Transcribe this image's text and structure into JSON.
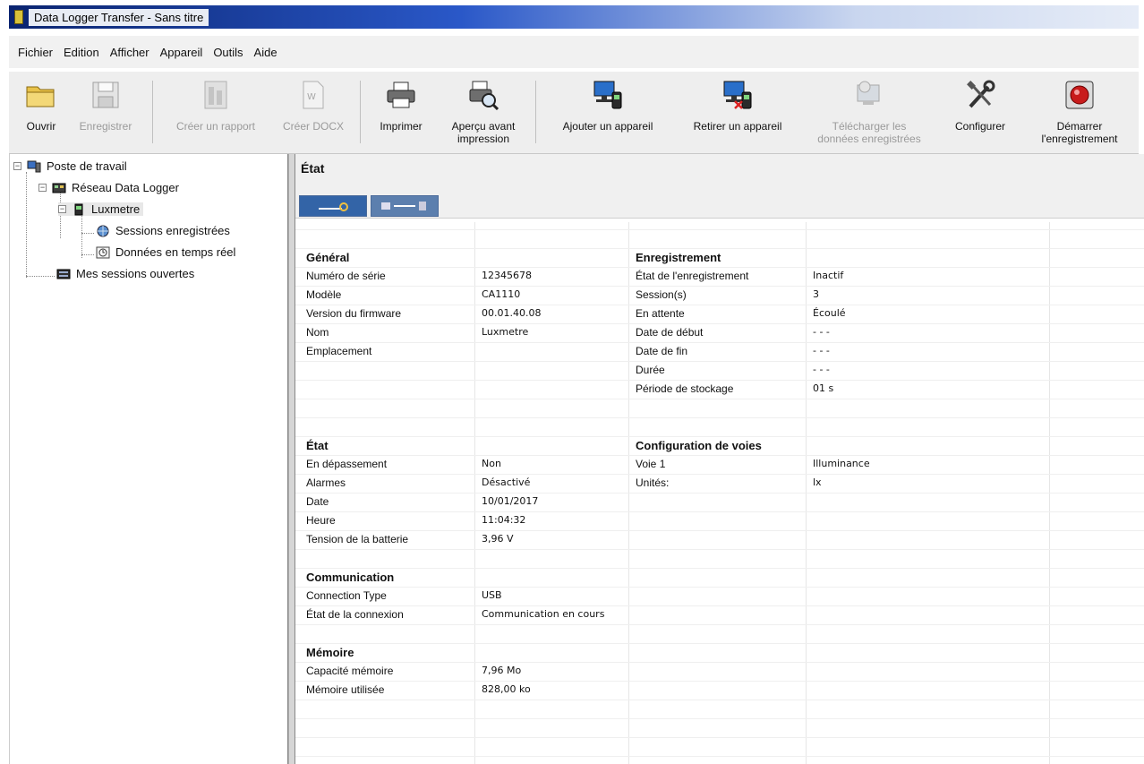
{
  "window": {
    "title": "Data Logger Transfer - Sans titre"
  },
  "menu": [
    "Fichier",
    "Edition",
    "Afficher",
    "Appareil",
    "Outils",
    "Aide"
  ],
  "toolbar": {
    "open": "Ouvrir",
    "save": "Enregistrer",
    "report": "Créer un rapport",
    "docx": "Créer DOCX",
    "print": "Imprimer",
    "preview_l1": "Aperçu avant",
    "preview_l2": "impression",
    "add_device": "Ajouter un appareil",
    "remove_device": "Retirer un appareil",
    "download_l1": "Télécharger les",
    "download_l2": "données enregistrées",
    "configure": "Configurer",
    "start_l1": "Démarrer",
    "start_l2": "l'enregistrement"
  },
  "tree": {
    "workstation": "Poste de travail",
    "network": "Réseau Data Logger",
    "device": "Luxmetre",
    "sessions": "Sessions enregistrées",
    "realtime": "Données en temps réel",
    "open_sessions": "Mes sessions ouvertes"
  },
  "panel": {
    "title": "État"
  },
  "left_sections": {
    "general": {
      "title": "Général",
      "rows": [
        {
          "label": "Numéro de série",
          "value": "12345678"
        },
        {
          "label": "Modèle",
          "value": "CA1110"
        },
        {
          "label": "Version du firmware",
          "value": "00.01.40.08"
        },
        {
          "label": "Nom",
          "value": "Luxmetre"
        },
        {
          "label": "Emplacement",
          "value": ""
        }
      ]
    },
    "etat": {
      "title": "État",
      "rows": [
        {
          "label": "En dépassement",
          "value": "Non"
        },
        {
          "label": "Alarmes",
          "value": "Désactivé"
        },
        {
          "label": "Date",
          "value": "10/01/2017"
        },
        {
          "label": "Heure",
          "value": "11:04:32"
        },
        {
          "label": "Tension de la batterie",
          "value": "3,96 V"
        }
      ]
    },
    "communication": {
      "title": "Communication",
      "rows": [
        {
          "label": "Connection Type",
          "value": "USB"
        },
        {
          "label": "État de la connexion",
          "value": "Communication en cours"
        }
      ]
    },
    "memoire": {
      "title": "Mémoire",
      "rows": [
        {
          "label": "Capacité mémoire",
          "value": "7,96 Mo"
        },
        {
          "label": "Mémoire utilisée",
          "value": "828,00 ko"
        }
      ]
    }
  },
  "right_sections": {
    "enregistrement": {
      "title": "Enregistrement",
      "rows": [
        {
          "label": "État de l'enregistrement",
          "value": "Inactif"
        },
        {
          "label": "Session(s)",
          "value": "3"
        },
        {
          "label": "En attente",
          "value": "Écoulé"
        },
        {
          "label": "Date de début",
          "value": "- - -"
        },
        {
          "label": "Date de fin",
          "value": "- - -"
        },
        {
          "label": "Durée",
          "value": "- - -"
        },
        {
          "label": "Période de stockage",
          "value": "01 s"
        }
      ]
    },
    "voies": {
      "title": "Configuration de voies",
      "rows": [
        {
          "label": "Voie 1",
          "value": "Illuminance"
        },
        {
          "label": "Unités:",
          "value": "lx"
        }
      ]
    }
  }
}
